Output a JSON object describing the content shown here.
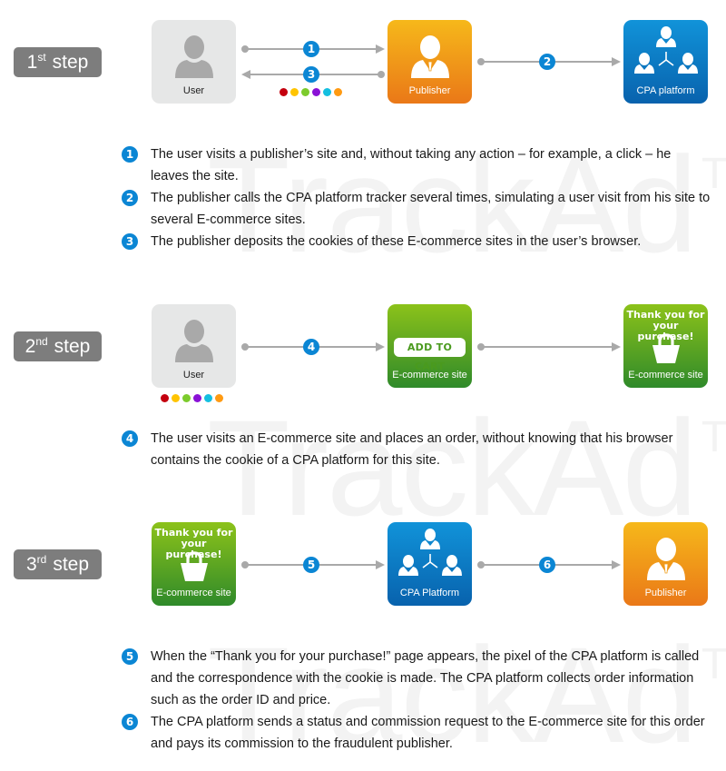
{
  "watermark": {
    "text": "TrackAd",
    "tm": "TM"
  },
  "colors": {
    "badge": "#7d7d7d",
    "number_circle": "#0b86d4",
    "connector": "#a9a9a9",
    "user_box": "#e6e7e7",
    "publisher_gradient": [
      "#f6b81a",
      "#ea7818"
    ],
    "cpa_gradient": [
      "#1193d9",
      "#0862ad"
    ],
    "ecommerce_gradient": [
      "#8cc21a",
      "#2f8a2a"
    ],
    "cookie_dots": [
      "#c4000e",
      "#ffc400",
      "#7ccb2c",
      "#8a12d6",
      "#14bfe0",
      "#ff9a12"
    ]
  },
  "steps": [
    {
      "badge": {
        "num": "1",
        "suffix": "st",
        "word": "step"
      },
      "nodes": [
        {
          "type": "user",
          "label": "User",
          "icon": "user-icon"
        },
        {
          "type": "publisher",
          "label": "Publisher",
          "icon": "publisher-icon"
        },
        {
          "type": "cpa",
          "label": "CPA platform",
          "icon": "network-icon"
        }
      ],
      "connectors": [
        {
          "number": "1",
          "direction": "right",
          "from": "User",
          "to": "Publisher"
        },
        {
          "number": "3",
          "direction": "left",
          "from": "Publisher",
          "to": "User"
        },
        {
          "number": "2",
          "direction": "right",
          "from": "Publisher",
          "to": "CPA platform"
        }
      ],
      "descriptions": [
        {
          "number": "1",
          "text": "The user visits a publisher’s site and, without taking any action – for example, a click – he leaves the site."
        },
        {
          "number": "2",
          "text": "The publisher calls the CPA platform tracker several times, simulating a user visit from his site to several E-commerce sites."
        },
        {
          "number": "3",
          "text": "The publisher deposits the cookies of these E-commerce sites in the user’s browser."
        }
      ]
    },
    {
      "badge": {
        "num": "2",
        "suffix": "nd",
        "word": "step"
      },
      "nodes": [
        {
          "type": "user",
          "label": "User",
          "icon": "user-icon"
        },
        {
          "type": "ecommerce",
          "label": "E-commerce site",
          "button": "ADD TO CART"
        },
        {
          "type": "ecommerce",
          "label": "E-commerce site",
          "headline": [
            "Thank you for",
            "your purchase!"
          ],
          "icon": "shopping-bag-icon"
        }
      ],
      "connectors": [
        {
          "number": "4",
          "direction": "right",
          "from": "User",
          "to": "E-commerce site"
        },
        {
          "number": "",
          "direction": "right",
          "from": "E-commerce site",
          "to": "E-commerce site"
        }
      ],
      "descriptions": [
        {
          "number": "4",
          "text": "The user visits an E-commerce site and places an order, without knowing that his browser contains the cookie of a CPA platform for this site."
        }
      ]
    },
    {
      "badge": {
        "num": "3",
        "suffix": "rd",
        "word": "step"
      },
      "nodes": [
        {
          "type": "ecommerce",
          "label": "E-commerce site",
          "headline": [
            "Thank you for",
            "your purchase!"
          ],
          "icon": "shopping-bag-icon"
        },
        {
          "type": "cpa",
          "label": "CPA Platform",
          "icon": "network-icon"
        },
        {
          "type": "publisher",
          "label": "Publisher",
          "icon": "publisher-icon"
        }
      ],
      "connectors": [
        {
          "number": "5",
          "direction": "right",
          "from": "E-commerce site",
          "to": "CPA Platform"
        },
        {
          "number": "6",
          "direction": "right",
          "from": "CPA Platform",
          "to": "Publisher"
        }
      ],
      "descriptions": [
        {
          "number": "5",
          "text": "When the “Thank you for your purchase!” page appears, the pixel of the CPA platform is called and the correspondence with the cookie is made. The CPA platform collects order information such as the order ID and price."
        },
        {
          "number": "6",
          "text": "The CPA platform sends a status and commission request to the E-commerce site for this order and pays its commission to the fraudulent publisher."
        }
      ]
    }
  ]
}
